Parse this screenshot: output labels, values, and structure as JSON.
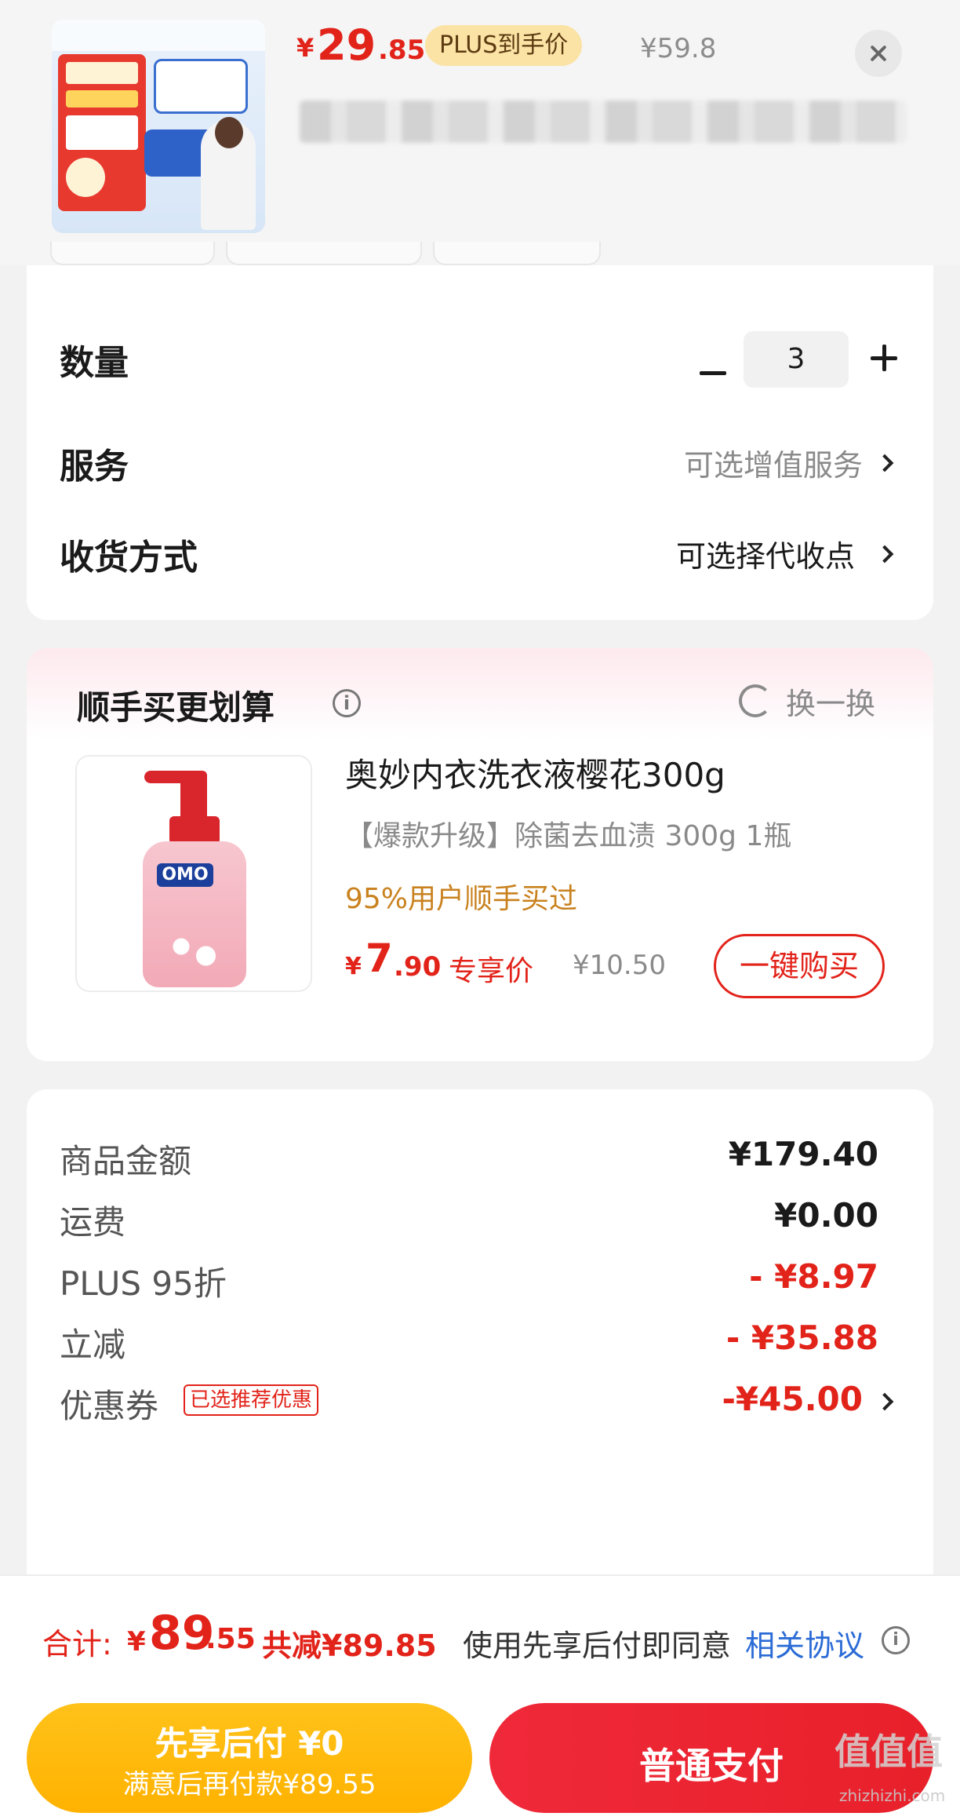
{
  "header": {
    "price_symbol": "¥",
    "price_int": "29",
    "price_dec": ".85",
    "plus_badge": "PLUS到手价",
    "original_price": "¥59.8"
  },
  "options": {
    "quantity_label": "数量",
    "quantity_value": "3",
    "service_label": "服务",
    "service_value": "可选增值服务",
    "delivery_label": "收货方式",
    "delivery_value": "可选择代收点"
  },
  "upsell": {
    "title": "顺手买更划算",
    "info_icon": "i",
    "swap_label": "换一换",
    "product_name": "奥妙内衣洗衣液樱花300g",
    "product_spec": "【爆款升级】除菌去血渍 300g 1瓶",
    "social_proof": "95%用户顺手买过",
    "price_symbol": "¥",
    "price_int": "7",
    "price_dec": ".90",
    "price_tag": "专享价",
    "original_price": "¥10.50",
    "buy_button": "一键购买",
    "brand_logo": "OMO"
  },
  "summary": {
    "rows": [
      {
        "label": "商品金额",
        "value": "¥179.40"
      },
      {
        "label": "运费",
        "value": "¥0.00"
      },
      {
        "label": "PLUS 95折",
        "value": "- ¥8.97"
      },
      {
        "label": "立减",
        "value": "- ¥35.88"
      },
      {
        "label": "优惠券",
        "value": "-¥45.00"
      }
    ],
    "coupon_tag": "已选推荐优惠"
  },
  "footer": {
    "total_label": "合计:",
    "total_symbol": "¥",
    "total_int": "89",
    "total_dec": ".55",
    "total_saved": "共减¥89.85",
    "agree_text": "使用先享后付即同意",
    "agree_link": "相关协议",
    "bnpl_title": "先享后付 ¥0",
    "bnpl_subtitle": "满意后再付款¥89.55",
    "pay_button": "普通支付"
  },
  "watermark": {
    "logo": "值值值",
    "url": "zhizhizhi.com"
  },
  "colors": {
    "accent_red": "#e2231a",
    "gold": "#ffb200",
    "link_blue": "#2b6bd6"
  }
}
